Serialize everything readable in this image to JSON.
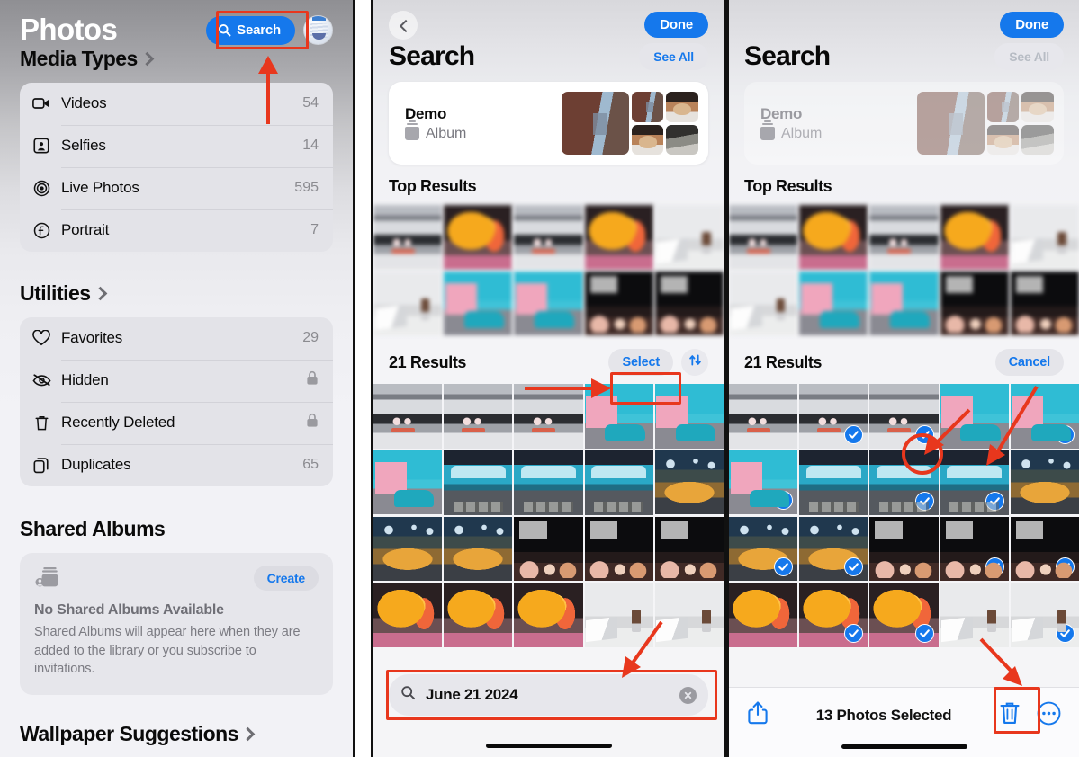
{
  "panel1": {
    "title": "Photos",
    "search_button": {
      "label": "Search",
      "icon": "search-icon"
    },
    "avatar": "user-avatar",
    "sections": [
      {
        "title": "Media Types",
        "chevron": "chevron-right-icon",
        "rows": [
          {
            "icon": "video-camera-icon",
            "label": "Videos",
            "value": "54"
          },
          {
            "icon": "selfie-portrait-icon",
            "label": "Selfies",
            "value": "14"
          },
          {
            "icon": "live-photo-icon",
            "label": "Live Photos",
            "value": "595"
          },
          {
            "icon": "portrait-f-icon",
            "label": "Portrait",
            "value": "7"
          }
        ]
      },
      {
        "title": "Utilities",
        "chevron": "chevron-right-icon",
        "rows": [
          {
            "icon": "heart-icon",
            "label": "Favorites",
            "value": "29"
          },
          {
            "icon": "eye-slash-icon",
            "label": "Hidden",
            "value": "",
            "locked": true
          },
          {
            "icon": "trash-icon",
            "label": "Recently Deleted",
            "value": "",
            "locked": true
          },
          {
            "icon": "duplicate-icon",
            "label": "Duplicates",
            "value": "65"
          }
        ]
      }
    ],
    "shared_albums": {
      "title": "Shared Albums",
      "create_label": "Create",
      "empty_title": "No Shared Albums Available",
      "empty_body": "Shared Albums will appear here when they are added to the library or you subscribe to invitations.",
      "icon": "shared-album-icon"
    },
    "wallpaper": {
      "title": "Wallpaper Suggestions",
      "chevron": "chevron-right-icon"
    }
  },
  "panel2": {
    "back": "back-chevron-icon",
    "done_label": "Done",
    "heading": "Search",
    "see_all_label": "See All",
    "album_card": {
      "name": "Demo",
      "type": "Album",
      "icon": "album-icon"
    },
    "top_results_label": "Top Results",
    "results_count_label": "21 Results",
    "select_label": "Select",
    "sort_icon": "sort-arrows-icon",
    "search_field": {
      "icon": "search-icon",
      "value": "June 21 2024",
      "placeholder": "Search",
      "clear_icon": "clear-x-icon"
    }
  },
  "panel3": {
    "done_label": "Done",
    "heading": "Search",
    "see_all_label": "See All",
    "album_card": {
      "name": "Demo",
      "type": "Album",
      "icon": "album-icon"
    },
    "top_results_label": "Top Results",
    "results_count_label": "21 Results",
    "cancel_label": "Cancel",
    "toolbar": {
      "share_icon": "share-icon",
      "status": "13 Photos Selected",
      "delete_icon": "trash-icon",
      "more_icon": "more-circle-icon"
    }
  },
  "colors": {
    "accent_blue": "#1578ec",
    "annotation_red": "#e8371d",
    "panel_bg": "#f2f2f6",
    "card_bg": "#e3e3e8",
    "check_blue": "#1578ec"
  },
  "grids": {
    "top_results_panel2": [
      "img-car",
      "img-drink",
      "img-car",
      "img-drink",
      "img-desk",
      "img-desk",
      "img-housecar",
      "img-housecar",
      "img-night",
      "img-night"
    ],
    "results_panel2": [
      "img-car",
      "img-car",
      "img-car",
      "img-housecar",
      "img-housecar",
      "img-housecar",
      "img-bluecar",
      "img-bluecar",
      "img-bluecar",
      "img-market",
      "img-market",
      "img-market",
      "img-night",
      "img-night",
      "img-night",
      "img-drink",
      "img-drink",
      "img-drink",
      "img-desk",
      "img-desk"
    ],
    "results_panel3_selected": [
      false,
      true,
      true,
      false,
      true,
      true,
      false,
      true,
      true,
      false,
      true,
      true,
      false,
      true,
      true,
      false,
      true,
      true,
      false,
      true
    ]
  },
  "annotations": {
    "panel1_search_highlight": "rectangle around Search button",
    "panel1_arrow": "arrow pointing up to Search button",
    "panel2_select_highlight": "rectangle around Select button",
    "panel2_select_arrow": "arrow pointing right to Select button",
    "panel2_searchfield_highlight": "rectangle around search field",
    "panel2_searchfield_arrow": "arrow pointing down-left to search field",
    "panel3_cancel_arrow": "arrow pointing up-right to Cancel",
    "panel3_checkmark_circle": "circle around a selection checkmark",
    "panel3_trash_highlight": "rectangle around trash icon",
    "panel3_trash_arrow": "arrow pointing down to trash icon"
  }
}
